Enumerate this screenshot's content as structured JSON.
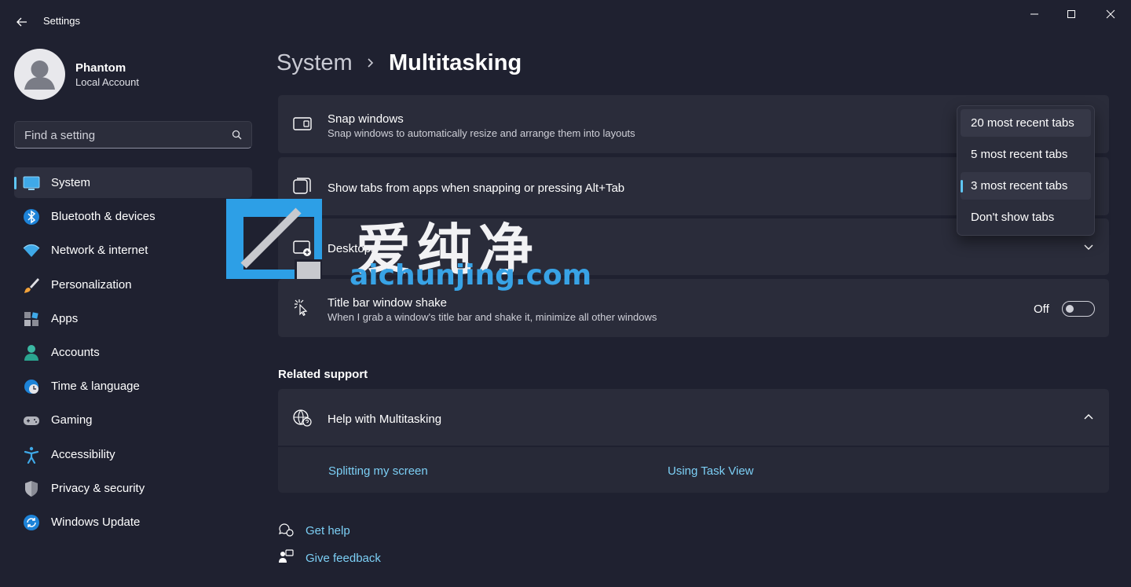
{
  "window": {
    "app_title": "Settings",
    "back_icon": "arrow-left-icon",
    "min_icon": "minimize-icon",
    "max_icon": "maximize-icon",
    "close_icon": "close-icon"
  },
  "user": {
    "name": "Phantom",
    "account_type": "Local Account"
  },
  "search": {
    "placeholder": "Find a setting",
    "icon": "search-icon"
  },
  "nav": {
    "items": [
      {
        "label": "System",
        "icon": "system-icon",
        "active": true
      },
      {
        "label": "Bluetooth & devices",
        "icon": "bluetooth-icon"
      },
      {
        "label": "Network & internet",
        "icon": "wifi-icon"
      },
      {
        "label": "Personalization",
        "icon": "brush-icon"
      },
      {
        "label": "Apps",
        "icon": "apps-icon"
      },
      {
        "label": "Accounts",
        "icon": "person-icon"
      },
      {
        "label": "Time & language",
        "icon": "globe-clock-icon"
      },
      {
        "label": "Gaming",
        "icon": "gamepad-icon"
      },
      {
        "label": "Accessibility",
        "icon": "accessibility-icon"
      },
      {
        "label": "Privacy & security",
        "icon": "shield-icon"
      },
      {
        "label": "Windows Update",
        "icon": "update-icon"
      }
    ]
  },
  "breadcrumb": {
    "parent": "System",
    "current": "Multitasking"
  },
  "settings": {
    "snap": {
      "title": "Snap windows",
      "description": "Snap windows to automatically resize and arrange them into layouts"
    },
    "tabs": {
      "title": "Show tabs from apps when snapping or pressing Alt+Tab"
    },
    "desktops": {
      "title": "Desktops"
    },
    "shake": {
      "title": "Title bar window shake",
      "description": "When I grab a window's title bar and shake it, minimize all other windows",
      "state": "Off"
    }
  },
  "dropdown": {
    "options": [
      "20 most recent tabs",
      "5 most recent tabs",
      "3 most recent tabs",
      "Don't show tabs"
    ],
    "selected": "3 most recent tabs",
    "hovered": "20 most recent tabs"
  },
  "related": {
    "heading": "Related support",
    "help_title": "Help with Multitasking",
    "links": [
      "Splitting my screen",
      "Using Task View"
    ]
  },
  "footer": {
    "get_help": "Get help",
    "give_feedback": "Give feedback"
  },
  "watermark": {
    "chinese": "爱纯净",
    "url": "aichunjing.com"
  },
  "colors": {
    "background": "#1f2130",
    "card": "#2a2c3a",
    "accent": "#5fc6f4",
    "link": "#7ccff5"
  }
}
